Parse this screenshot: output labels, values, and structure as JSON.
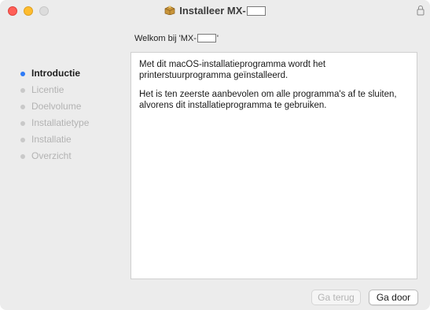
{
  "window": {
    "title_prefix": "Installeer MX-",
    "icons": {
      "app": "package-icon",
      "lock": "lock-icon"
    }
  },
  "header": {
    "welcome_prefix": "Welkom bij 'MX-",
    "welcome_suffix": "'"
  },
  "sidebar": {
    "steps": [
      {
        "label": "Introductie",
        "active": true
      },
      {
        "label": "Licentie",
        "active": false
      },
      {
        "label": "Doelvolume",
        "active": false
      },
      {
        "label": "Installatietype",
        "active": false
      },
      {
        "label": "Installatie",
        "active": false
      },
      {
        "label": "Overzicht",
        "active": false
      }
    ]
  },
  "content": {
    "paragraphs": [
      "Met dit macOS-installatieprogramma wordt het printerstuurprogramma geïnstalleerd.",
      "Het is ten zeerste aanbevolen om alle programma's af te sluiten, alvorens dit installatieprogramma te gebruiken."
    ]
  },
  "buttons": {
    "back_label": "Ga terug",
    "next_label": "Ga door"
  },
  "colors": {
    "active_step": "#2f7bf6",
    "close": "#ff5f57",
    "minimize": "#febc2e",
    "zoom_disabled": "#dcdcdc"
  }
}
